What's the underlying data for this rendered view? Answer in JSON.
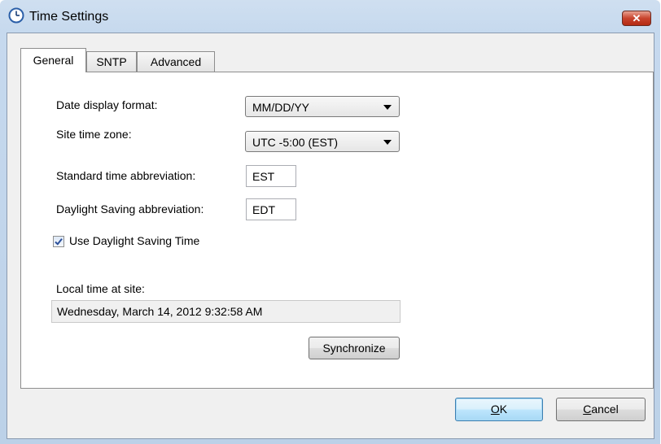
{
  "window": {
    "title": "Time Settings",
    "close_label": "✕"
  },
  "tabs": [
    {
      "label": "General",
      "active": true
    },
    {
      "label": "SNTP",
      "active": false
    },
    {
      "label": "Advanced",
      "active": false
    }
  ],
  "general": {
    "date_format_label": "Date display format:",
    "date_format_value": "MM/DD/YY",
    "time_zone_label": "Site time zone:",
    "time_zone_value": "UTC -5:00 (EST)",
    "std_abbrev_label": "Standard time abbreviation:",
    "std_abbrev_value": "EST",
    "dst_abbrev_label": "Daylight Saving abbreviation:",
    "dst_abbrev_value": "EDT",
    "use_dst_label": "Use Daylight Saving Time",
    "use_dst_checked": true,
    "local_time_label": "Local time at site:",
    "local_time_value": "Wednesday, March 14, 2012 9:32:58 AM",
    "synchronize_label": "Synchronize"
  },
  "footer": {
    "ok_mnemonic": "O",
    "ok_rest": "K",
    "cancel_mnemonic": "C",
    "cancel_rest": "ancel"
  },
  "colors": {
    "title_bar": "#c6d9ee",
    "close_button": "#c8432d",
    "default_button_border": "#3c7fb1",
    "client_bg": "#f0f0f0"
  }
}
